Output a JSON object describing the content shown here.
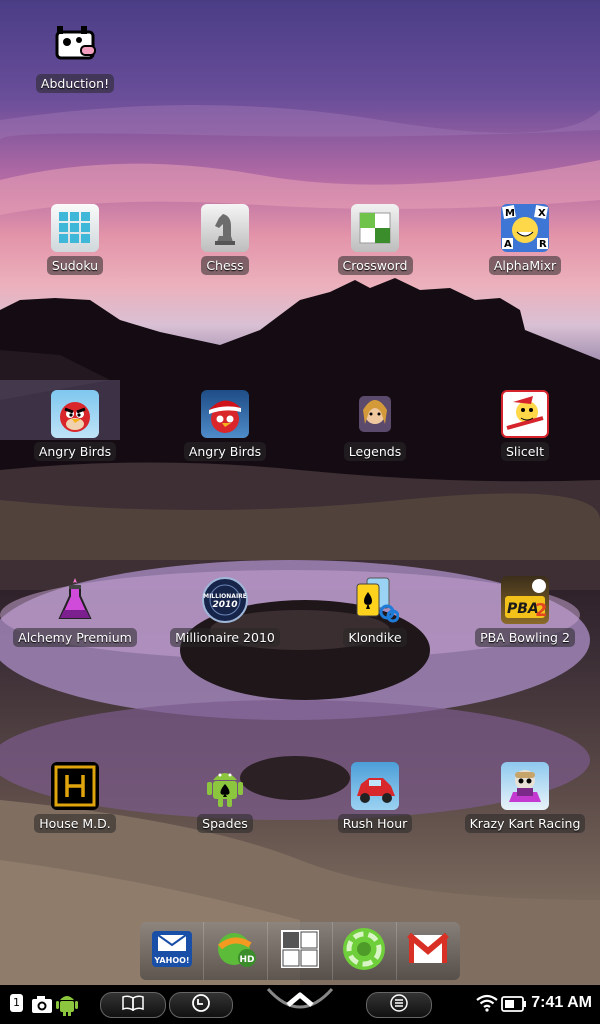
{
  "desktop": {
    "apps": [
      {
        "label": "Abduction!",
        "icon": "abduction-cow-icon"
      },
      {
        "label": "Sudoku",
        "icon": "sudoku-grid-icon"
      },
      {
        "label": "Chess",
        "icon": "chess-knight-icon"
      },
      {
        "label": "Crossword",
        "icon": "crossword-icon"
      },
      {
        "label": "AlphaMixr",
        "icon": "alphamixr-icon"
      },
      {
        "label": "Angry Birds",
        "icon": "angry-birds-icon"
      },
      {
        "label": "Angry Birds",
        "icon": "angry-birds-seasons-icon"
      },
      {
        "label": "Legends",
        "icon": "legends-icon"
      },
      {
        "label": "SliceIt",
        "icon": "sliceit-icon"
      },
      {
        "label": "Alchemy Premium",
        "icon": "alchemy-flask-icon"
      },
      {
        "label": "Millionaire 2010",
        "icon": "millionaire-icon"
      },
      {
        "label": "Klondike",
        "icon": "klondike-cards-icon"
      },
      {
        "label": "PBA Bowling 2",
        "icon": "pba-bowling-icon"
      },
      {
        "label": "House M.D.",
        "icon": "house-md-icon"
      },
      {
        "label": "Spades",
        "icon": "spades-android-icon"
      },
      {
        "label": "Rush Hour",
        "icon": "rush-hour-car-icon"
      },
      {
        "label": "Krazy Kart Racing",
        "icon": "krazy-kart-icon"
      }
    ]
  },
  "dock": {
    "items": [
      {
        "name": "yahoo-mail",
        "icon": "yahoo-mail-icon",
        "text": "YAHOO!"
      },
      {
        "name": "hd-app",
        "icon": "hd-globe-icon",
        "text": "HD"
      },
      {
        "name": "app-drawer",
        "icon": "app-grid-icon",
        "text": ""
      },
      {
        "name": "launcher",
        "icon": "green-ring-icon",
        "text": ""
      },
      {
        "name": "gmail",
        "icon": "gmail-icon",
        "text": ""
      }
    ]
  },
  "statusbar": {
    "notification_count": "1",
    "time": "7:41 AM",
    "icons": [
      "camera-icon",
      "android-icon",
      "book-icon",
      "back-icon",
      "home-chevron-icon",
      "menu-icon",
      "wifi-icon",
      "battery-icon"
    ]
  }
}
